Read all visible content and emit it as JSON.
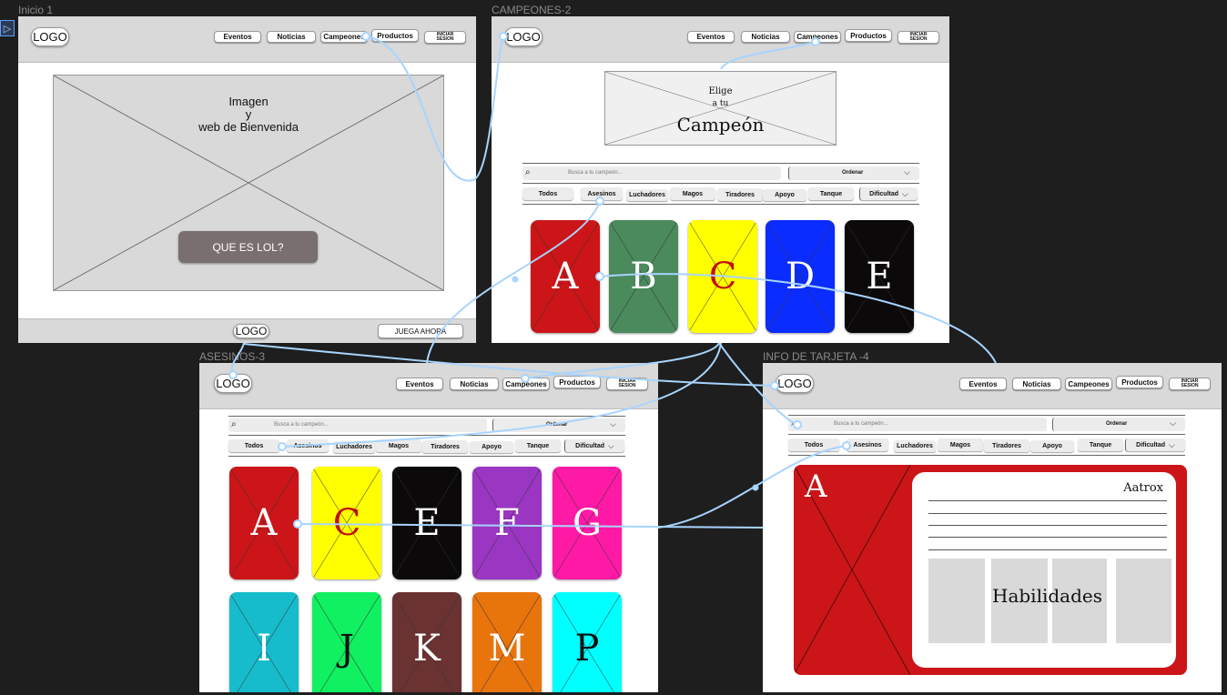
{
  "frames": {
    "inicio": {
      "label": "Inicio 1"
    },
    "campeones": {
      "label": "CAMPEONES-2"
    },
    "asesinos": {
      "label": "ASESINOS-3"
    },
    "info": {
      "label": "INFO DE TARJETA -4"
    }
  },
  "nav": {
    "logo": "LOGO",
    "eventos": "Eventos",
    "noticias": "Noticias",
    "campeones": "Campeones",
    "productos": "Productos",
    "iniciar_sesion": "INICIAR\nSESION"
  },
  "inicio": {
    "hero_text_1": "Imagen",
    "hero_text_2": "y",
    "hero_text_3": "web de Bienvenida",
    "cta": "QUE ES LOL?",
    "footer_logo": "LOGO",
    "footer_cta": "JUEGA AHORA"
  },
  "campeones": {
    "banner_1": "Elige",
    "banner_2": "a tu",
    "banner_3": "Campeón",
    "cards": [
      "A",
      "B",
      "C",
      "D",
      "E"
    ]
  },
  "search": {
    "placeholder": "Busca a tu campeón...",
    "sort": "Ordenar"
  },
  "filters": {
    "todos": "Todos",
    "asesinos": "Asesinos",
    "luchadores": "Luchadores",
    "magos": "Magos",
    "tiradores": "Tiradores",
    "apoyo": "Apoyo",
    "tanque": "Tanque",
    "dificultad": "Dificultad"
  },
  "asesinos": {
    "row1": [
      "A",
      "C",
      "E",
      "F",
      "G"
    ],
    "row2": [
      "I",
      "J",
      "K",
      "M",
      "P"
    ]
  },
  "info": {
    "letter": "A",
    "name": "Aatrox",
    "abilities": "Habilidades"
  },
  "colors": {
    "canvas": "#1e1e1e",
    "wire": "#a8d4ff",
    "red": "#cc1518",
    "green": "#4a8a5c",
    "yellow": "#ffff00",
    "blue": "#0a2cff",
    "black": "#0b0909",
    "purple": "#9b36c2",
    "magenta": "#ff1aa6",
    "teal": "#16bccb",
    "lime": "#10f060",
    "brown": "#6b3232",
    "orange": "#e8740c",
    "cyan": "#00ffff"
  }
}
